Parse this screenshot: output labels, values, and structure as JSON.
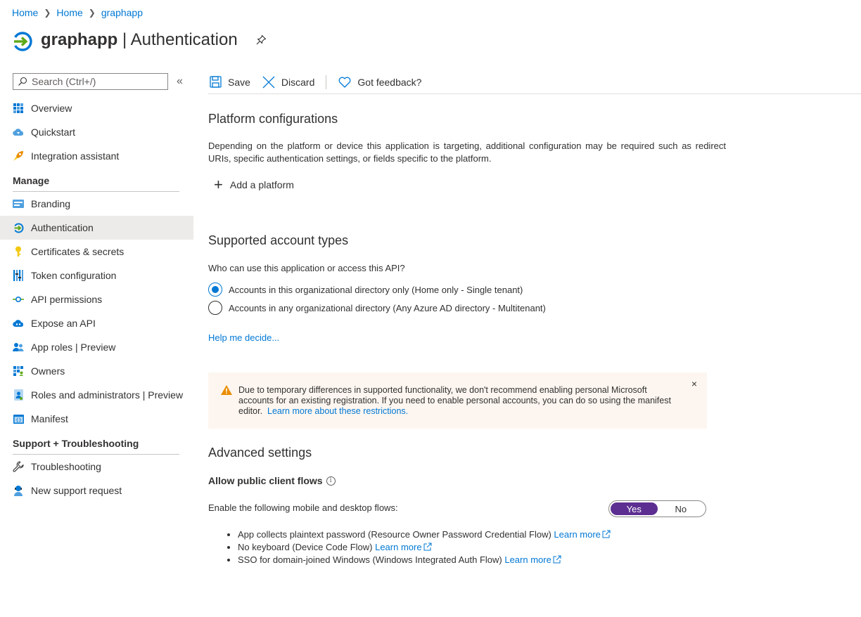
{
  "breadcrumb": [
    "Home",
    "Home",
    "graphapp"
  ],
  "title": {
    "app": "graphapp",
    "separator": " | ",
    "page": "Authentication"
  },
  "sidebar": {
    "search_placeholder": "Search (Ctrl+/)",
    "collapse": "«",
    "items_top": [
      {
        "label": "Overview",
        "icon": "overview-grid-icon"
      },
      {
        "label": "Quickstart",
        "icon": "quickstart-cloud-icon"
      },
      {
        "label": "Integration assistant",
        "icon": "rocket-icon"
      }
    ],
    "manage_header": "Manage",
    "manage_items": [
      {
        "label": "Branding",
        "icon": "branding-icon"
      },
      {
        "label": "Authentication",
        "icon": "authentication-icon",
        "active": true
      },
      {
        "label": "Certificates & secrets",
        "icon": "key-icon"
      },
      {
        "label": "Token configuration",
        "icon": "token-bars-icon"
      },
      {
        "label": "API permissions",
        "icon": "api-permissions-icon"
      },
      {
        "label": "Expose an API",
        "icon": "expose-api-cloud-icon"
      },
      {
        "label": "App roles | Preview",
        "icon": "app-roles-icon"
      },
      {
        "label": "Owners",
        "icon": "owners-icon"
      },
      {
        "label": "Roles and administrators | Preview",
        "icon": "roles-admin-icon"
      },
      {
        "label": "Manifest",
        "icon": "manifest-icon"
      }
    ],
    "support_header": "Support + Troubleshooting",
    "support_items": [
      {
        "label": "Troubleshooting",
        "icon": "wrench-icon"
      },
      {
        "label": "New support request",
        "icon": "support-person-icon"
      }
    ]
  },
  "toolbar": {
    "save": "Save",
    "discard": "Discard",
    "feedback": "Got feedback?"
  },
  "platform": {
    "title": "Platform configurations",
    "description": "Depending on the platform or device this application is targeting, additional configuration may be required such as redirect URIs, specific authentication settings, or fields specific to the platform.",
    "add_label": "Add a platform"
  },
  "accounts": {
    "title": "Supported account types",
    "question": "Who can use this application or access this API?",
    "options": [
      {
        "label": "Accounts in this organizational directory only (Home only - Single tenant)",
        "selected": true
      },
      {
        "label": "Accounts in any organizational directory (Any Azure AD directory - Multitenant)",
        "selected": false
      }
    ],
    "help_link": "Help me decide..."
  },
  "warning": {
    "text": "Due to temporary differences in supported functionality, we don't recommend enabling personal Microsoft accounts for an existing registration. If you need to enable personal accounts, you can do so using the manifest editor.",
    "link": "Learn more about these restrictions.",
    "close": "×"
  },
  "advanced": {
    "title": "Advanced settings",
    "public_client_title": "Allow public client flows",
    "info": "i",
    "enable_label": "Enable the following mobile and desktop flows:",
    "toggle": {
      "yes": "Yes",
      "no": "No",
      "value": "Yes"
    },
    "flows": [
      {
        "text": "App collects plaintext password (Resource Owner Password Credential Flow)",
        "link": "Learn more"
      },
      {
        "text": "No keyboard (Device Code Flow)",
        "link": "Learn more"
      },
      {
        "text": "SSO for domain-joined Windows (Windows Integrated Auth Flow)",
        "link": "Learn more"
      }
    ]
  },
  "colors": {
    "accent": "#0078d4",
    "toggle_on": "#5c2e91",
    "warning_bg": "#fdf6f0",
    "warning_icon": "#ea8c00"
  }
}
